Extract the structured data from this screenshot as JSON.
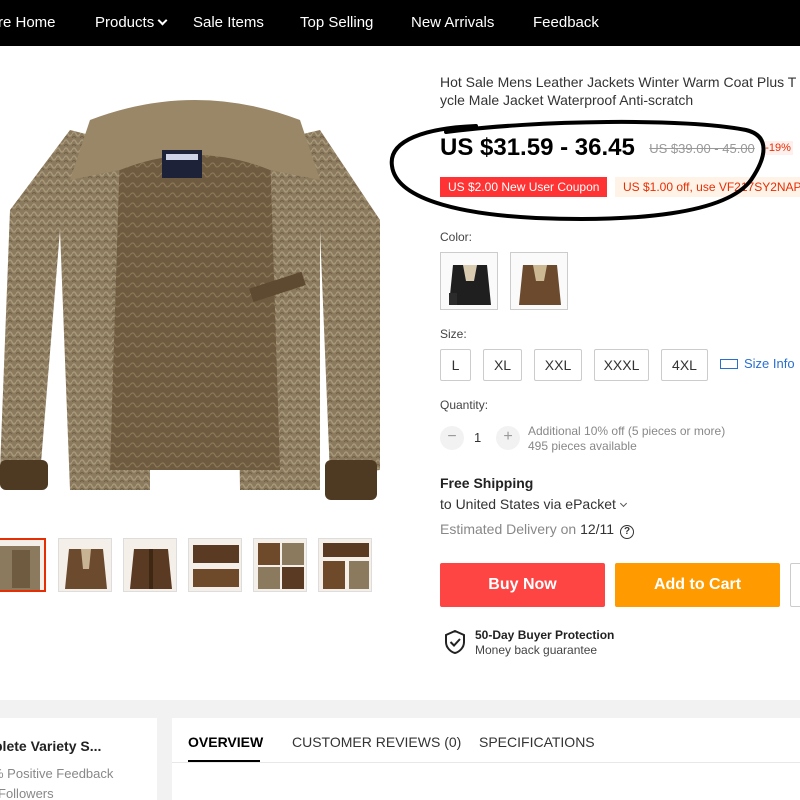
{
  "nav": {
    "items": [
      "re Home",
      "Products",
      "Sale Items",
      "Top Selling",
      "New Arrivals",
      "Feedback"
    ]
  },
  "product": {
    "title_line1": "Hot Sale Mens Leather Jackets Winter Warm Coat Plus T",
    "title_line2": "ycle Male Jacket Waterproof Anti-scratch",
    "price": "US $31.59 - 36.45",
    "original_price": "US $39.00 - 45.00",
    "discount": "-19%",
    "coupon_new_user": "US $2.00 New User Coupon",
    "coupon_code": "US $1.00 off, use VF217SY2NAP"
  },
  "color": {
    "label": "Color:",
    "options": [
      "black-jacket",
      "brown-jacket"
    ]
  },
  "size": {
    "label": "Size:",
    "options": [
      "L",
      "XL",
      "XXL",
      "XXXL",
      "4XL"
    ],
    "info_label": "Size Info"
  },
  "quantity": {
    "label": "Quantity:",
    "value": "1",
    "minus": "−",
    "plus": "+",
    "note1": "Additional 10% off (5 pieces or more)",
    "note2": "495 pieces available"
  },
  "shipping": {
    "title": "Free Shipping",
    "to": "to United States via ePacket",
    "delivery_prefix": "Estimated Delivery on",
    "delivery_date": "12/11"
  },
  "actions": {
    "buy_now": "Buy Now",
    "add_to_cart": "Add to Cart"
  },
  "protection": {
    "title": "50-Day Buyer Protection",
    "subtitle": "Money back guarantee"
  },
  "store": {
    "name": "plete Variety S...",
    "feedback": "% Positive Feedback",
    "followers": "Followers"
  },
  "tabs": [
    "OVERVIEW",
    "CUSTOMER REVIEWS (0)",
    "SPECIFICATIONS"
  ],
  "colors": {
    "nav_bg": "#000000",
    "buy_now": "#ff4444",
    "add_to_cart": "#ff9a00",
    "coupon_red": "#ff3333",
    "accent_red": "#e62e04",
    "link_blue": "#2a6fd0"
  }
}
